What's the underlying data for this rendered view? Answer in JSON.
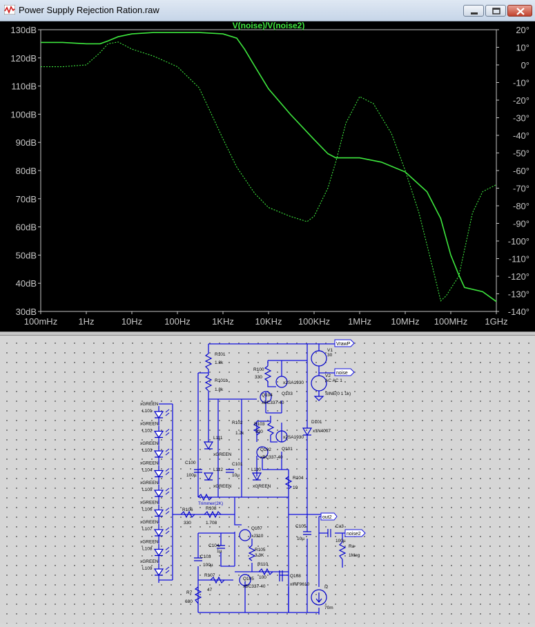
{
  "window": {
    "title": "Power Supply Rejection Ration.raw"
  },
  "plot": {
    "trace_label": "V(noise)/V(noise2)",
    "left_axis": [
      "130dB",
      "120dB",
      "110dB",
      "100dB",
      "90dB",
      "80dB",
      "70dB",
      "60dB",
      "50dB",
      "40dB",
      "30dB"
    ],
    "right_axis": [
      "20°",
      "10°",
      "0°",
      "-10°",
      "-20°",
      "-30°",
      "-40°",
      "-50°",
      "-60°",
      "-70°",
      "-80°",
      "-90°",
      "-100°",
      "-110°",
      "-120°",
      "-130°",
      "-140°"
    ],
    "x_axis": [
      "100mHz",
      "1Hz",
      "10Hz",
      "100Hz",
      "1KHz",
      "10KHz",
      "100KHz",
      "1MHz",
      "10MHz",
      "100MHz",
      "1GHz"
    ],
    "colors": {
      "trace": "#3ee83e",
      "background": "#000000",
      "axis_text": "#c8c8c8"
    }
  },
  "chart_data": {
    "type": "line",
    "title": "V(noise)/V(noise2)",
    "x_scale": "log",
    "xlim": [
      0.1,
      1000000000
    ],
    "ylim_left": [
      30,
      130
    ],
    "ylim_right": [
      -140,
      20
    ],
    "series": [
      {
        "axis": "left",
        "style": "solid",
        "x": [
          0.1,
          0.3,
          1,
          2,
          3,
          5,
          10,
          30,
          100,
          300,
          1000,
          2000,
          3000,
          5000,
          10000,
          30000,
          100000,
          200000,
          300000,
          500000,
          1000000,
          3000000,
          10000000,
          30000000,
          60000000,
          100000000,
          150000000,
          200000000,
          500000000,
          1000000000
        ],
        "y": [
          125.5,
          125.5,
          125,
          125,
          126,
          127.5,
          128.5,
          129,
          129,
          129,
          128.5,
          127,
          123,
          117,
          109,
          100,
          91,
          86,
          84.5,
          84.5,
          84.5,
          83,
          79.5,
          72.5,
          63,
          50,
          43,
          38.5,
          37,
          33.5
        ]
      },
      {
        "axis": "right",
        "style": "dotted",
        "x": [
          0.1,
          0.3,
          1,
          2,
          3,
          5,
          10,
          30,
          100,
          300,
          1000,
          2000,
          5000,
          10000,
          30000,
          70000,
          100000,
          200000,
          300000,
          500000,
          1000000,
          2000000,
          5000000,
          10000000,
          20000000,
          40000000,
          60000000,
          80000000,
          100000000,
          150000000,
          300000000,
          500000000,
          1000000000
        ],
        "y": [
          -1,
          -1,
          0,
          7,
          12,
          13,
          9,
          5,
          -1,
          -13,
          -42,
          -58,
          -73,
          -81,
          -86,
          -89,
          -86,
          -70,
          -55,
          -33,
          -18,
          -22,
          -39,
          -60,
          -84,
          -115,
          -134,
          -131,
          -127,
          -120,
          -84,
          -72,
          -68
        ]
      }
    ]
  },
  "schematic": {
    "nets": {
      "top": "VrawP",
      "noise": "noise",
      "out": "out2",
      "noise2": "noise2"
    },
    "components": [
      {
        "ref": "V1",
        "value": "30"
      },
      {
        "ref": "V2",
        "value": "AC AC 1",
        "value2": "SINE(0 1 1k)"
      },
      {
        "ref": "R101",
        "value": "1.8k"
      },
      {
        "ref": "R101b",
        "value": "1.8k"
      },
      {
        "ref": "R100",
        "value": "330"
      },
      {
        "ref": "Q103",
        "value": "x2SA1930"
      },
      {
        "ref": "Q104",
        "value": "xBC337-40"
      },
      {
        "ref": "R102",
        "value": "1.2k"
      },
      {
        "ref": "R103",
        "value": "330"
      },
      {
        "ref": "Q101",
        "value": "x2SA1930"
      },
      {
        "ref": "Q102",
        "value": "xBC337-40"
      },
      {
        "ref": "D101",
        "value": "x1N4007"
      },
      {
        "ref": "R104",
        "value": "10"
      },
      {
        "ref": "L111",
        "value": "xGREEN"
      },
      {
        "ref": "L112",
        "value": "xGREEN"
      },
      {
        "ref": "L110",
        "value": "xGREEN"
      },
      {
        "ref": "C100",
        "value": "100µ"
      },
      {
        "ref": "C101",
        "value": "10µ"
      },
      {
        "ref": "Trimmer",
        "value": "Trimmer(2K)"
      },
      {
        "ref": "R106",
        "value": "330"
      },
      {
        "ref": "R108",
        "value": "1.708"
      },
      {
        "ref": "C105",
        "value": "10µ"
      },
      {
        "ref": "Ca3",
        "value": "100µ"
      },
      {
        "ref": "Ra",
        "value": "1Meg"
      },
      {
        "ref": "Q107",
        "value": "xJ310"
      },
      {
        "ref": "C104",
        "value": "1µ"
      },
      {
        "ref": "C103",
        "value": "100µ"
      },
      {
        "ref": "R105",
        "value": "3.3K"
      },
      {
        "ref": "R110",
        "value": "100"
      },
      {
        "ref": "Q108",
        "value": "xIRF9610"
      },
      {
        "ref": "Q105",
        "value": "xBC337-40"
      },
      {
        "ref": "R107",
        "value": "47"
      },
      {
        "ref": "R7",
        "value": "680"
      },
      {
        "ref": "I2",
        "value": "70m"
      }
    ],
    "led_string": [
      {
        "ref": "L101",
        "value": "xGREEN"
      },
      {
        "ref": "L102",
        "value": "xGREEN"
      },
      {
        "ref": "L103",
        "value": "xGREEN"
      },
      {
        "ref": "L104",
        "value": "xGREEN"
      },
      {
        "ref": "L105",
        "value": "xGREEN"
      },
      {
        "ref": "L106",
        "value": "xGREEN"
      },
      {
        "ref": "L107",
        "value": "xGREEN"
      },
      {
        "ref": "L108",
        "value": "xGREEN"
      },
      {
        "ref": "L109",
        "value": "xGREEN"
      }
    ],
    "colors": {
      "wire": "#1010e0",
      "text": "#000000",
      "component": "#0000cc"
    }
  }
}
